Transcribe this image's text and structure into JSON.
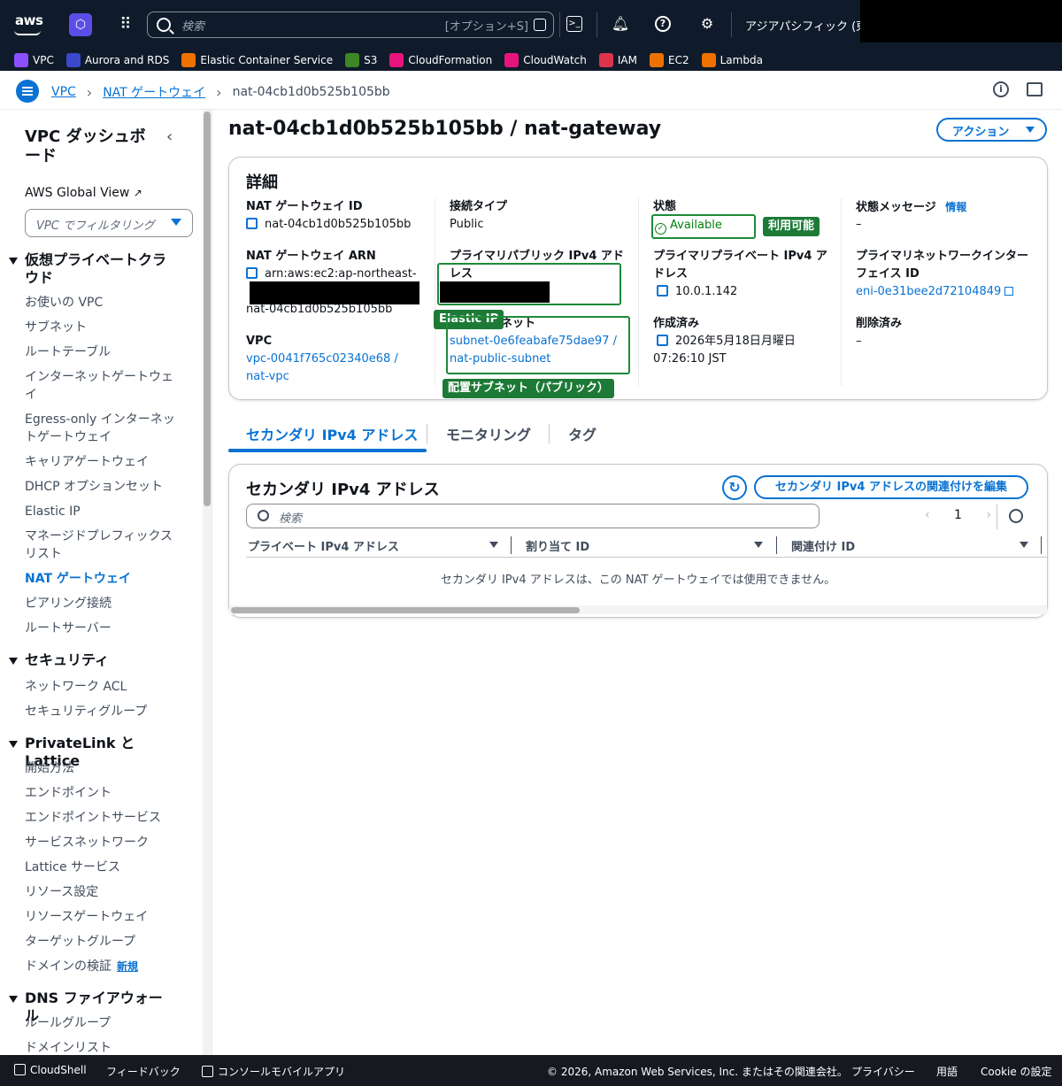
{
  "topnav": {
    "logo": "aws",
    "search_placeholder": "検索",
    "search_shortcut": "[オプション+S]",
    "region": "アジアパシフィック (東京)"
  },
  "favorites": [
    {
      "label": "VPC",
      "color": "#8c4fff"
    },
    {
      "label": "Aurora and RDS",
      "color": "#3b48cc"
    },
    {
      "label": "Elastic Container Service",
      "color": "#ed7100"
    },
    {
      "label": "S3",
      "color": "#3f8624"
    },
    {
      "label": "CloudFormation",
      "color": "#e7157b"
    },
    {
      "label": "CloudWatch",
      "color": "#e7157b"
    },
    {
      "label": "IAM",
      "color": "#dd344c"
    },
    {
      "label": "EC2",
      "color": "#ed7100"
    },
    {
      "label": "Lambda",
      "color": "#ed7100"
    }
  ],
  "breadcrumb": {
    "items": [
      "VPC",
      "NAT ゲートウェイ"
    ],
    "current": "nat-04cb1d0b525b105bb"
  },
  "sidebar": {
    "title": "VPC ダッシュボード",
    "global_view": "AWS Global View",
    "filter_placeholder": "VPC でフィルタリング",
    "sections": [
      {
        "label": "仮想プライベートクラウド",
        "items": [
          "お使いの VPC",
          "サブネット",
          "ルートテーブル",
          "インターネットゲートウェイ",
          "Egress-only インターネットゲートウェイ",
          "キャリアゲートウェイ",
          "DHCP オプションセット",
          "Elastic IP",
          "マネージドプレフィックスリスト",
          "NAT ゲートウェイ",
          "ピアリング接続",
          "ルートサーバー"
        ]
      },
      {
        "label": "セキュリティ",
        "items": [
          "ネットワーク ACL",
          "セキュリティグループ"
        ]
      },
      {
        "label": "PrivateLink と Lattice",
        "items": [
          "開始方法",
          "エンドポイント",
          "エンドポイントサービス",
          "サービスネットワーク",
          "Lattice サービス",
          "リソース設定",
          "リソースゲートウェイ",
          "ターゲットグループ",
          "ドメインの検証"
        ]
      },
      {
        "label": "DNS ファイアウォール",
        "items": [
          "ルールグループ",
          "ドメインリスト"
        ]
      }
    ],
    "active_item": "NAT ゲートウェイ",
    "new_badge": "新規"
  },
  "page": {
    "title": "nat-04cb1d0b525b105bb / nat-gateway",
    "action_label": "アクション"
  },
  "details": {
    "header": "詳細",
    "nat_id_label": "NAT ゲートウェイ ID",
    "nat_id": "nat-04cb1d0b525b105bb",
    "nat_arn_label": "NAT ゲートウェイ ARN",
    "nat_arn_prefix": "arn:aws:ec2:ap-northeast-",
    "nat_arn_suffix": "nat-04cb1d0b525b105bb",
    "vpc_label": "VPC",
    "vpc_value": "vpc-0041f765c02340e68 / nat-vpc",
    "conn_type_label": "接続タイプ",
    "conn_type": "Public",
    "public_ip_label": "プライマリパブリック IPv4 アドレス",
    "subnet_label": "サブネット",
    "subnet_value": "subnet-0e6feabafe75dae97 / nat-public-subnet",
    "state_label": "状態",
    "state": "Available",
    "private_ip_label": "プライマリプライベート IPv4 アドレス",
    "private_ip": "10.0.1.142",
    "created_label": "作成済み",
    "created": "2026年5月18日月曜日 07:26:10 JST",
    "state_msg_label": "状態メッセージ",
    "info_link": "情報",
    "state_msg": "–",
    "eni_label": "プライマリネットワークインターフェイス ID",
    "eni": "eni-0e31bee2d72104849",
    "deleted_label": "削除済み",
    "deleted": "–"
  },
  "annotations": {
    "available_tag": "利用可能",
    "elastic_ip_tag": "Elastic IP",
    "subnet_tag": "配置サブネット（パブリック）",
    "color": "#1d7a36"
  },
  "tabs": [
    "セカンダリ IPv4 アドレス",
    "モニタリング",
    "タグ"
  ],
  "secondary": {
    "header": "セカンダリ IPv4 アドレス",
    "edit_button": "セカンダリ IPv4 アドレスの関連付けを編集",
    "search_placeholder": "検索",
    "page": "1",
    "columns": [
      "プライベート IPv4 アドレス",
      "割り当て ID",
      "関連付け ID"
    ],
    "empty_message": "セカンダリ IPv4 アドレスは、この NAT ゲートウェイでは使用できません。"
  },
  "footer": {
    "cloudshell": "CloudShell",
    "feedback": "フィードバック",
    "mobile_app": "コンソールモバイルアプリ",
    "copyright": "© 2026, Amazon Web Services, Inc. またはその関連会社。",
    "privacy": "プライバシー",
    "terms": "用語",
    "cookie": "Cookie の設定"
  }
}
